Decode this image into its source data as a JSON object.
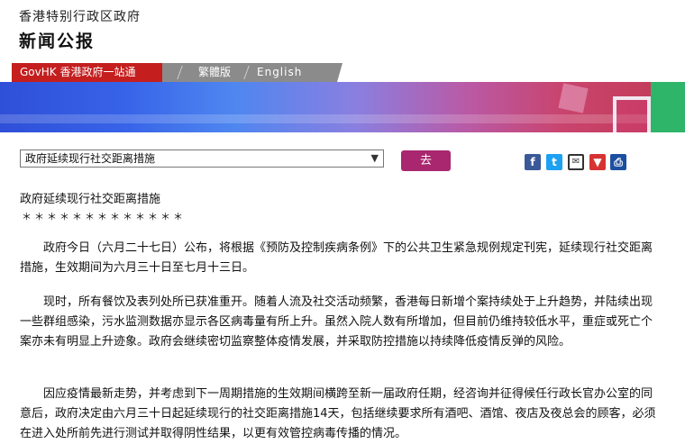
{
  "header": {
    "gov_name": "香港特别行政区政府",
    "press_title": "新闻公报"
  },
  "nav": {
    "govhk": "GovHK 香港政府一站通",
    "traditional": "繁體版",
    "english": "English"
  },
  "selector": {
    "selected": "政府延续现行社交距离措施",
    "go_label": "去"
  },
  "share": {
    "facebook": "f",
    "twitter": "t",
    "email": "✉",
    "download": "▼",
    "print": "⎙"
  },
  "article": {
    "title": "政府延续现行社交距离措施",
    "stars": "＊＊＊＊＊＊＊＊＊＊＊＊＊",
    "paragraphs": [
      "政府今日（六月二十七日）公布，将根据《预防及控制疾病条例》下的公共卫生紧急规例规定刊宪，延续现行社交距离措施，生效期间为六月三十日至七月十三日。",
      "现时，所有餐饮及表列处所已获准重开。随着人流及社交活动频繁，香港每日新增个案持续处于上升趋势，并陆续出现一些群组感染，污水监测数据亦显示各区病毒量有所上升。虽然入院人数有所增加，但目前仍维持较低水平，重症或死亡个案亦未有明显上升迹象。政府会继续密切监察整体疫情发展，并采取防控措施以持续降低疫情反弹的风险。",
      "因应疫情最新走势，并考虑到下一周期措施的生效期间横跨至新一届政府任期，经咨询并征得候任行政长官办公室的同意后，政府决定由六月三十日起延续现行的社交距离措施14天，包括继续要求所有酒吧、酒馆、夜店及夜总会的顾客，必须在进入处所前先进行测试并取得阴性结果，以更有效管控病毒传播的情况。"
    ]
  },
  "colors": {
    "nav_red": "#c41e1e",
    "go_button": "#a8276f"
  }
}
